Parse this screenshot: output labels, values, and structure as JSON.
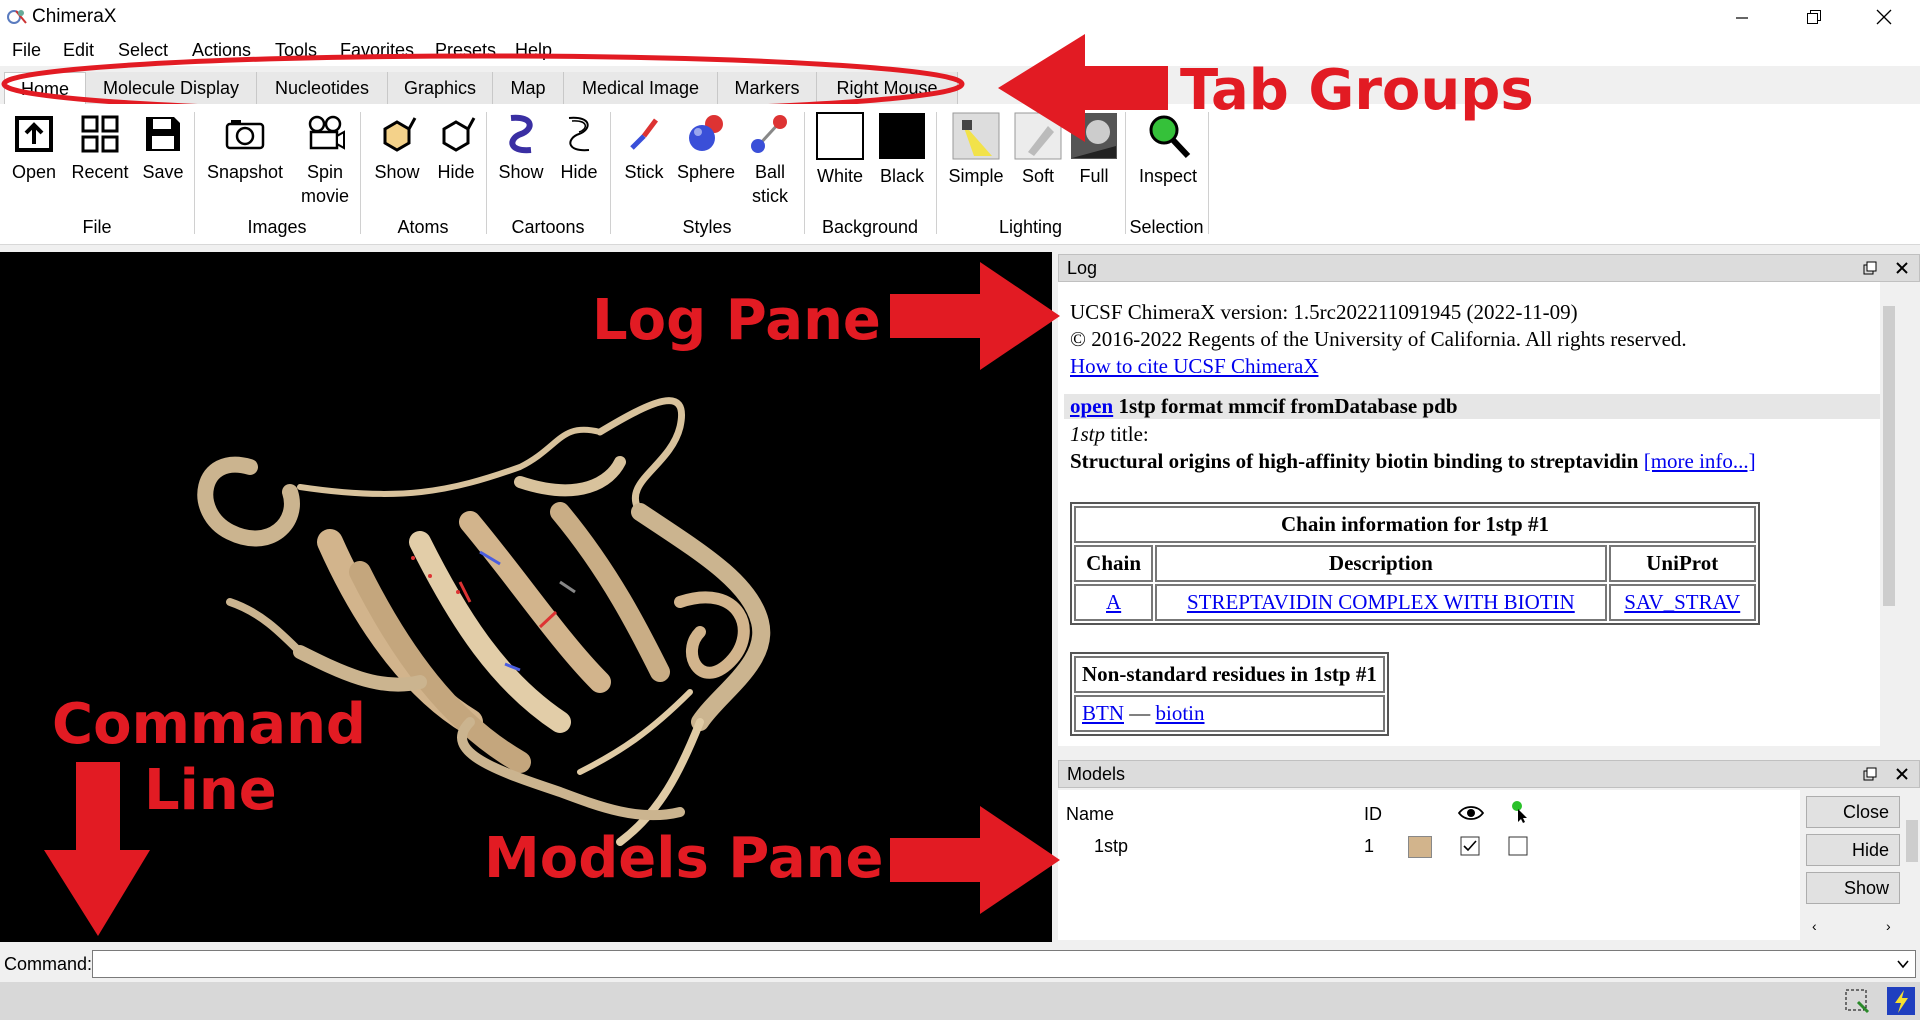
{
  "window": {
    "title": "ChimeraX"
  },
  "menubar": [
    "File",
    "Edit",
    "Select",
    "Actions",
    "Tools",
    "Favorites",
    "Presets",
    "Help"
  ],
  "tabs": [
    "Home",
    "Molecule Display",
    "Nucleotides",
    "Graphics",
    "Map",
    "Medical Image",
    "Markers",
    "Right Mouse"
  ],
  "toolbar": {
    "groups": [
      "File",
      "Images",
      "Atoms",
      "Cartoons",
      "Styles",
      "Background",
      "Lighting",
      "Selection"
    ],
    "buttons": {
      "open": "Open",
      "recent": "Recent",
      "save": "Save",
      "snapshot": "Snapshot",
      "spin1": "Spin",
      "spin2": "movie",
      "atoms_show": "Show",
      "atoms_hide": "Hide",
      "cartoons_show": "Show",
      "cartoons_hide": "Hide",
      "stick": "Stick",
      "sphere": "Sphere",
      "ball1": "Ball",
      "ball2": "stick",
      "white": "White",
      "black": "Black",
      "simple": "Simple",
      "soft": "Soft",
      "full": "Full",
      "inspect": "Inspect"
    }
  },
  "log": {
    "title": "Log",
    "version_line": "UCSF ChimeraX version: 1.5rc202211091945 (2022-11-09)",
    "copyright_line": "© 2016-2022 Regents of the University of California. All rights reserved.",
    "cite_link": "How to cite UCSF ChimeraX",
    "command_link": "open",
    "command_rest": " 1stp format mmcif fromDatabase pdb",
    "title_id": "1stp",
    "title_label": " title:",
    "structure_title": "Structural origins of high-affinity biotin binding to streptavidin",
    "more_info": "[more info...]",
    "chain_table": {
      "caption": "Chain information for 1stp #1",
      "headers": [
        "Chain",
        "Description",
        "UniProt"
      ],
      "row": [
        "A",
        "STREPTAVIDIN COMPLEX WITH BIOTIN",
        "SAV_STRAV"
      ]
    },
    "residue_table": {
      "caption": "Non-standard residues in 1stp #1",
      "code": "BTN",
      "dash": " — ",
      "name": "biotin"
    }
  },
  "models": {
    "title": "Models",
    "headers": {
      "name": "Name",
      "id": "ID"
    },
    "row": {
      "name": "1stp",
      "id": "1",
      "shown": true,
      "selected": false,
      "color": "#d2b48c"
    },
    "buttons": [
      "Close",
      "Hide",
      "Show"
    ]
  },
  "command": {
    "label": "Command:",
    "value": ""
  },
  "annotations": {
    "tab_groups": "Tab Groups",
    "log_pane": "Log Pane",
    "command_line_1": "Command",
    "command_line_2": "Line",
    "models_pane": "Models Pane"
  },
  "colors": {
    "annotation": "#e21b23",
    "ribbon": "#d2b48c",
    "link": "#0000ee"
  }
}
